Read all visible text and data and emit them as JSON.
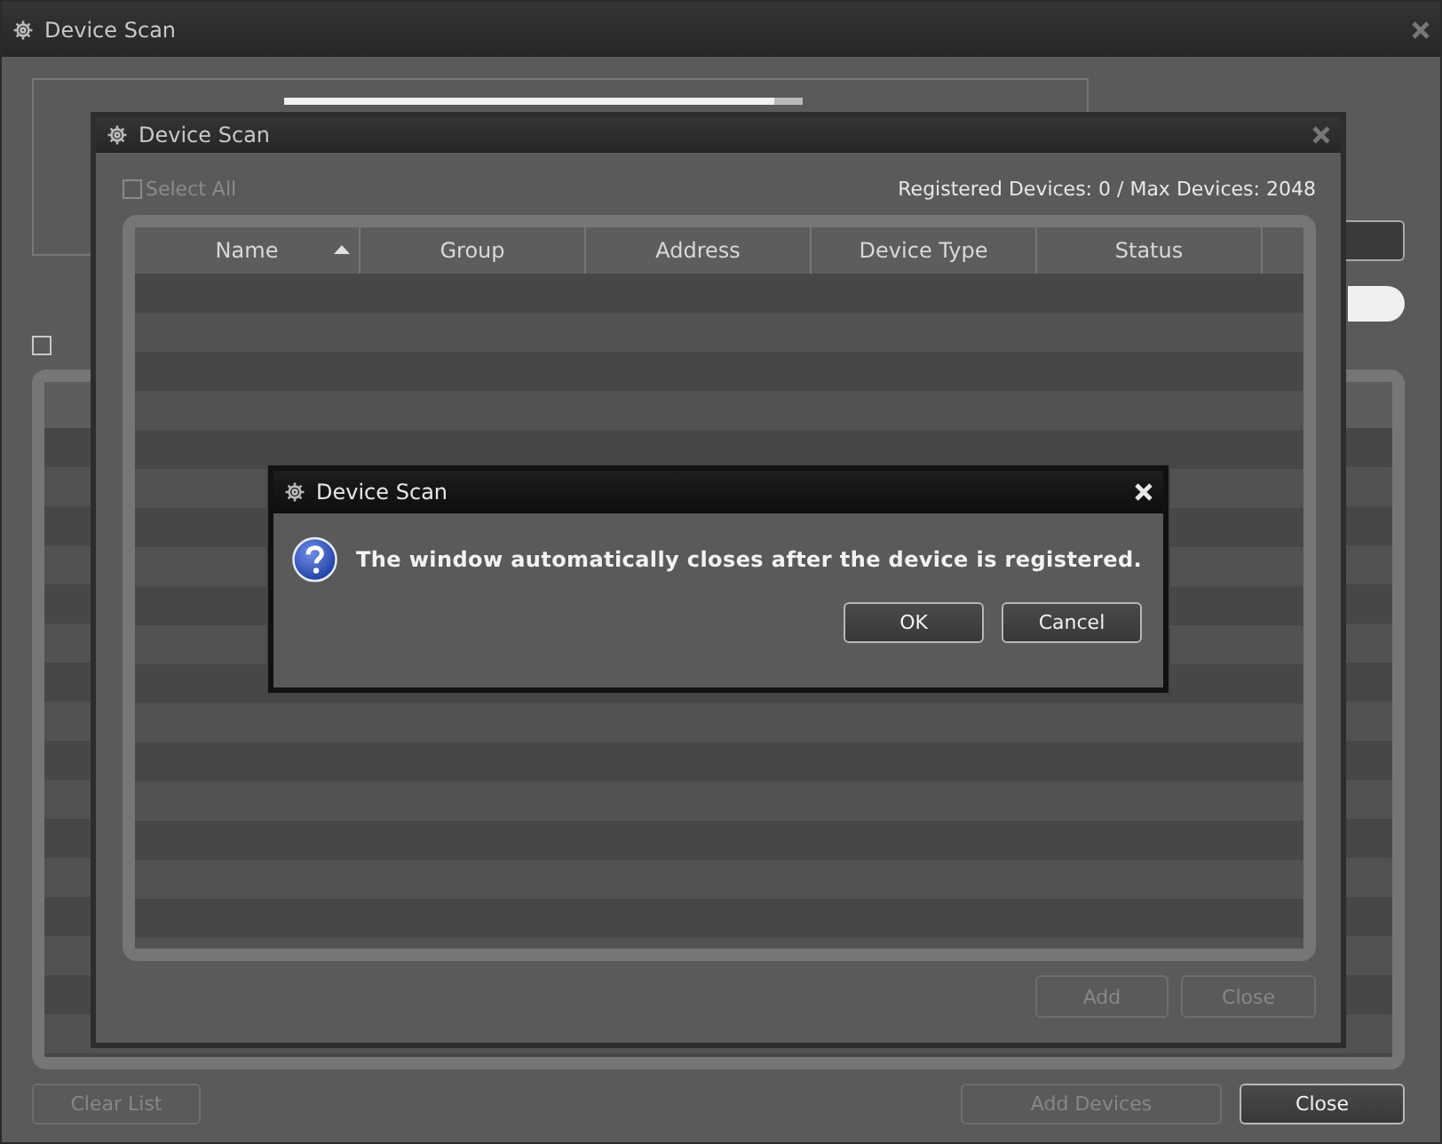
{
  "window": {
    "title": "Device Scan",
    "select_all": {
      "checked": false
    },
    "buttons": [
      {
        "label": "Clear List",
        "disabled": true
      },
      {
        "label": "Add Devices",
        "disabled": true
      },
      {
        "label": "Close",
        "disabled": false
      }
    ]
  },
  "scan_window": {
    "title": "Device Scan",
    "select_all": {
      "label": "Select All",
      "checked": false,
      "disabled": true
    },
    "registered": "Registered Devices: 0 / Max Devices: 2048",
    "table": {
      "columns": [
        {
          "label": "Name",
          "sorted": true
        },
        {
          "label": "Group",
          "sorted": false
        },
        {
          "label": "Address",
          "sorted": false
        },
        {
          "label": "Device Type",
          "sorted": false
        },
        {
          "label": "Status",
          "sorted": false
        }
      ]
    },
    "buttons": [
      {
        "label": "Add",
        "disabled": true
      },
      {
        "label": "Close",
        "disabled": true
      }
    ]
  },
  "dialog": {
    "title": "Device Scan",
    "message": "The window automatically closes after the device is registered.",
    "buttons": [
      {
        "label": "OK",
        "disabled": false
      },
      {
        "label": "Cancel",
        "disabled": false
      }
    ]
  }
}
